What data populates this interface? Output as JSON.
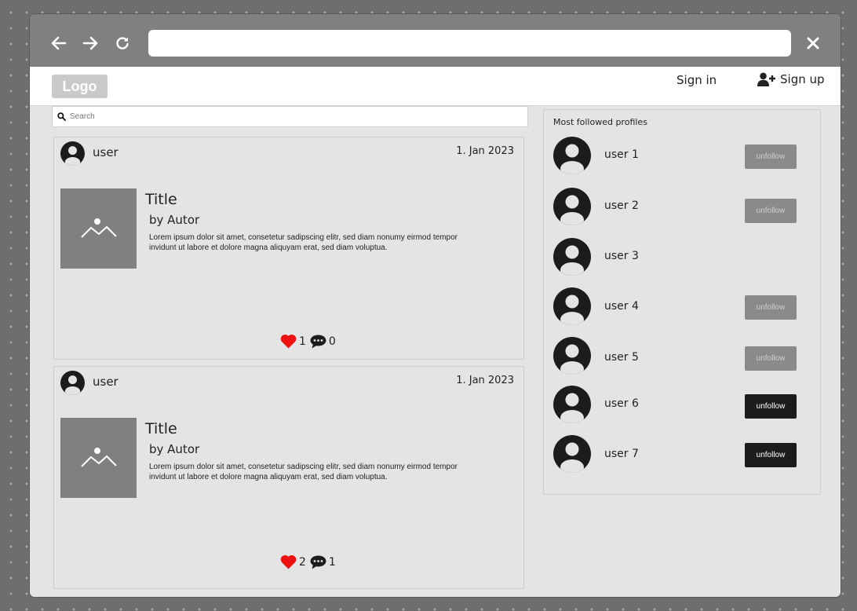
{
  "browser": {
    "back_icon": "arrow-left-icon",
    "forward_icon": "arrow-right-icon",
    "reload_icon": "reload-icon",
    "close_icon": "close-icon",
    "url": ""
  },
  "header": {
    "logo": "Logo",
    "sign_in": "Sign in",
    "sign_up": "Sign up",
    "sign_up_icon": "user-plus-icon"
  },
  "search": {
    "placeholder": "Search",
    "value": ""
  },
  "posts": [
    {
      "user": "user",
      "date": "1. Jan 2023",
      "title": "Title",
      "author": "by Autor",
      "excerpt": "Lorem ipsum dolor sit amet, consetetur sadipscing elitr, sed diam nonumy eirmod tempor invidunt ut labore et dolore magna aliquyam erat, sed diam voluptua.",
      "likes": "1",
      "comments": "0"
    },
    {
      "user": "user",
      "date": "1. Jan 2023",
      "title": "Title",
      "author": "by Autor",
      "excerpt": "Lorem ipsum dolor sit amet, consetetur sadipscing elitr, sed diam nonumy eirmod tempor invidunt ut labore et dolore magna aliquyam erat, sed diam voluptua.",
      "likes": "2",
      "comments": "1"
    }
  ],
  "sidebar": {
    "title": "Most followed profiles",
    "profiles": [
      {
        "name": "user 1",
        "button": "unfollow",
        "style": "gray"
      },
      {
        "name": "user 2",
        "button": "unfollow",
        "style": "gray"
      },
      {
        "name": "user 3",
        "button": null,
        "style": "none"
      },
      {
        "name": "user 4",
        "button": "unfollow",
        "style": "gray"
      },
      {
        "name": "user 5",
        "button": "unfollow",
        "style": "gray"
      },
      {
        "name": "user 6",
        "button": "unfollow",
        "style": "dark"
      },
      {
        "name": "user 7",
        "button": "unfollow",
        "style": "dark"
      }
    ]
  },
  "colors": {
    "heart": "#ee1111",
    "button_gray": "#8a8a8a",
    "button_dark": "#1c1c1c",
    "chrome": "#808080"
  }
}
